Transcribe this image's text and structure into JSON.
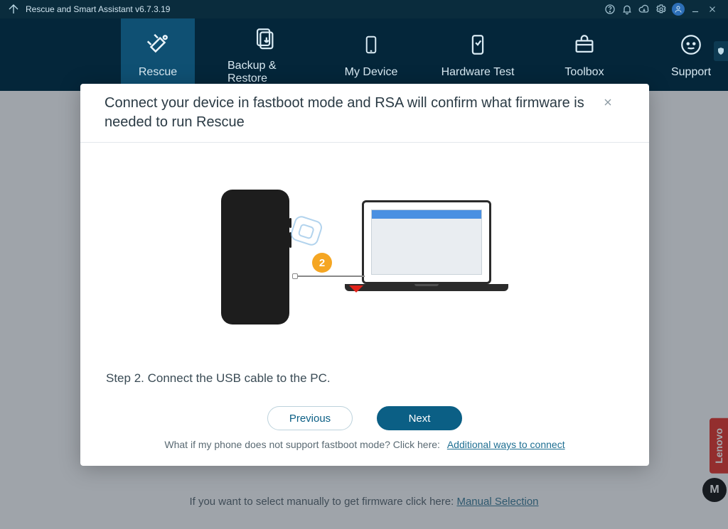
{
  "app": {
    "title": "Rescue and Smart Assistant v6.7.3.19"
  },
  "nav": {
    "items": [
      {
        "label": "Rescue"
      },
      {
        "label": "Backup & Restore"
      },
      {
        "label": "My Device"
      },
      {
        "label": "Hardware Test"
      },
      {
        "label": "Toolbox"
      },
      {
        "label": "Support"
      }
    ]
  },
  "modal": {
    "title": "Connect your device in fastboot mode and RSA will confirm what firmware is needed to run Rescue",
    "step_badge": "2",
    "step_text": "Step 2. Connect the USB cable to the PC.",
    "previous": "Previous",
    "next": "Next",
    "hint_text": "What if my phone does not support fastboot mode? Click here:",
    "hint_link": "Additional ways to connect"
  },
  "footer": {
    "manual_text": "If you want to select manually to get firmware click here:",
    "manual_link": "Manual Selection"
  },
  "side": {
    "lenovo": "Lenovo",
    "moto": "M"
  }
}
